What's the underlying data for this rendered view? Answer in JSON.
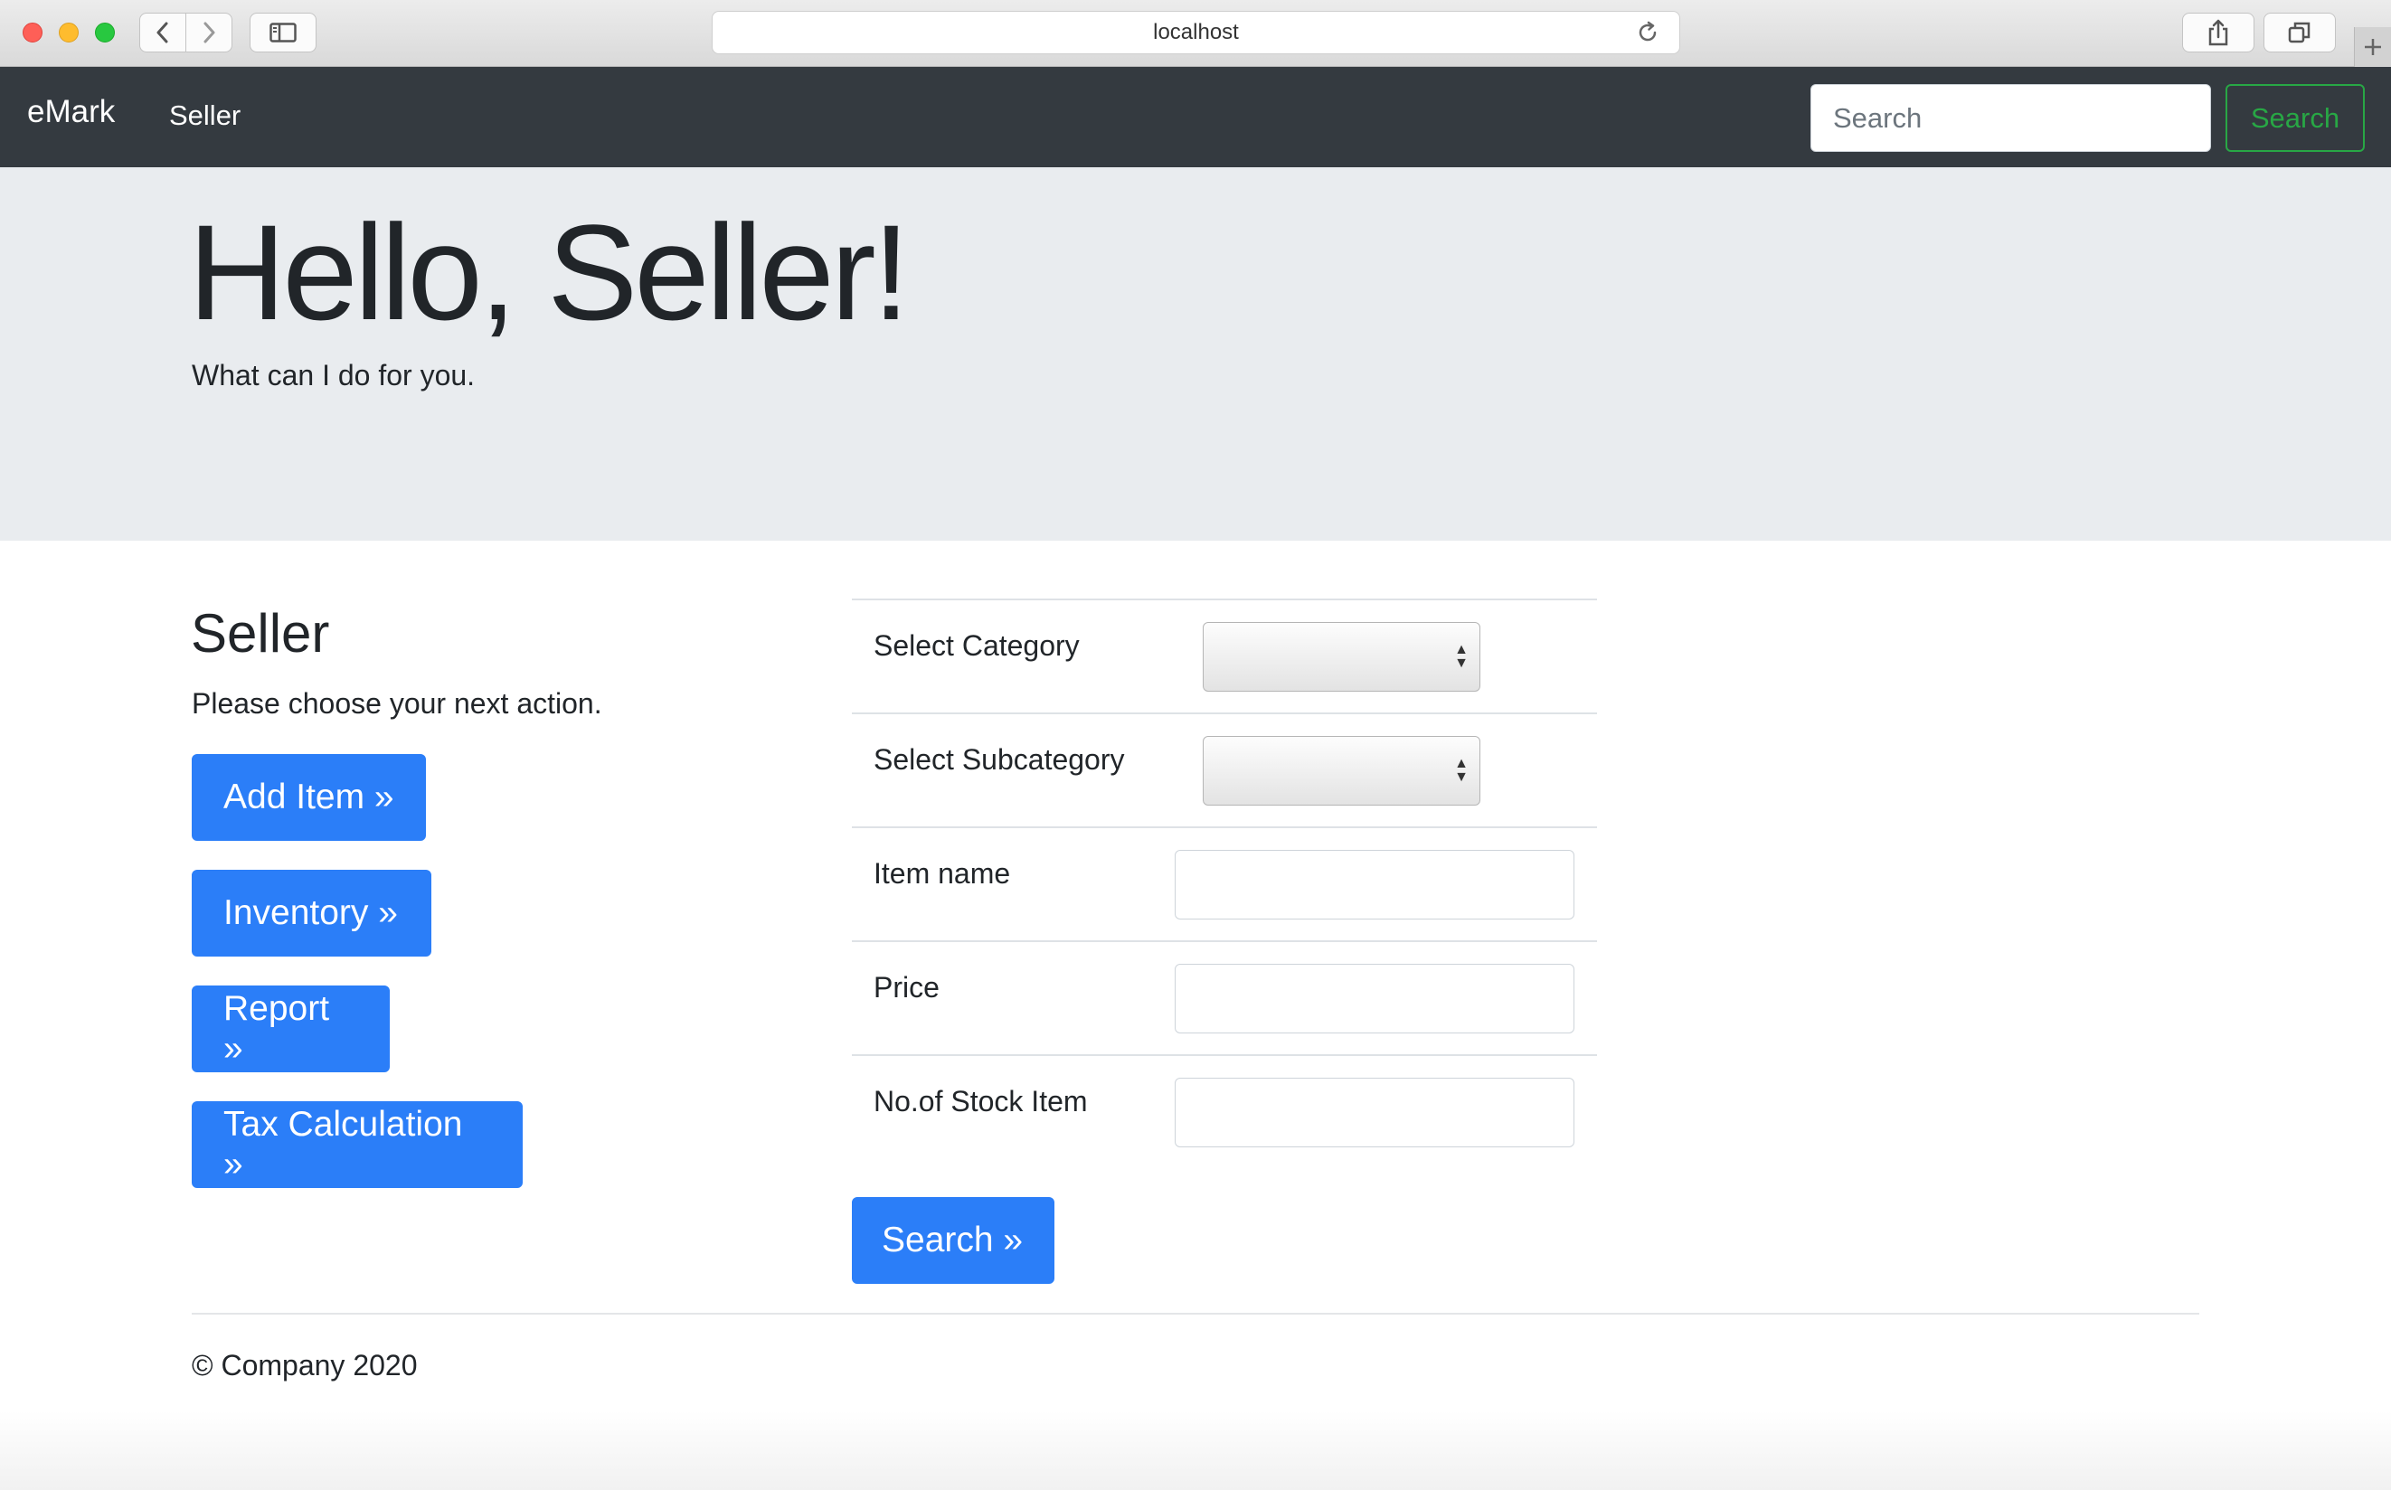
{
  "browser": {
    "url": "localhost"
  },
  "navbar": {
    "brand": "eMark",
    "link": "Seller",
    "search_placeholder": "Search",
    "search_button": "Search"
  },
  "jumbotron": {
    "title": "Hello, Seller!",
    "subtitle": "What can I do for you."
  },
  "seller": {
    "title": "Seller",
    "subtitle": "Please choose your next action.",
    "actions": [
      "Add Item »",
      "Inventory »",
      "Report »",
      "Tax Calculation »"
    ]
  },
  "form": {
    "fields": [
      {
        "label": "Select Category",
        "type": "select",
        "value": ""
      },
      {
        "label": "Select Subcategory",
        "type": "select",
        "value": ""
      },
      {
        "label": "Item name",
        "type": "text",
        "value": ""
      },
      {
        "label": "Price",
        "type": "text",
        "value": ""
      },
      {
        "label": "No.of Stock Item",
        "type": "text",
        "value": ""
      }
    ],
    "submit": "Search »"
  },
  "footer": {
    "text": "© Company 2020"
  },
  "colors": {
    "navbar_bg": "#343a40",
    "jumbotron_bg": "#e9ecef",
    "primary": "#2b7ef8",
    "success": "#28a745"
  }
}
